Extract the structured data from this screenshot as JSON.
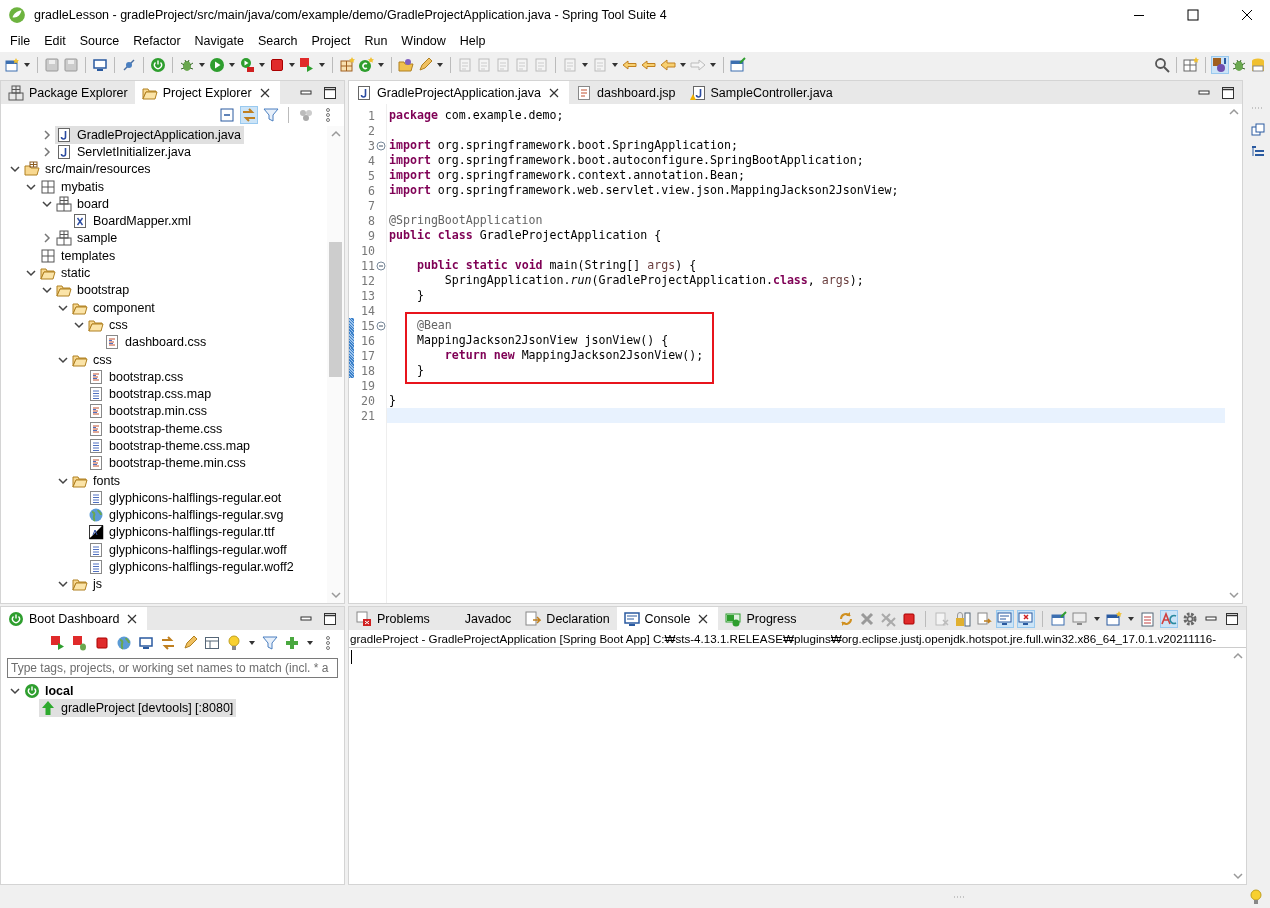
{
  "window": {
    "title": "gradleLesson - gradleProject/src/main/java/com/example/demo/GradleProjectApplication.java - Spring Tool Suite 4"
  },
  "menu": [
    "File",
    "Edit",
    "Source",
    "Refactor",
    "Navigate",
    "Search",
    "Project",
    "Run",
    "Window",
    "Help"
  ],
  "explorer": {
    "tabs": [
      {
        "label": "Package Explorer",
        "selected": false
      },
      {
        "label": "Project Explorer",
        "selected": true
      }
    ],
    "link_with_editor": true,
    "scrolled_items": [
      {
        "label": "GradleProjectApplication.java",
        "kind": "java",
        "expanded": false,
        "selected": true
      },
      {
        "label": "ServletInitializer.java",
        "kind": "java",
        "expanded": false,
        "selected": false
      }
    ],
    "tree": [
      {
        "label": "src/main/resources",
        "kind": "source-folder",
        "expanded": true,
        "selected": false,
        "children": [
          {
            "label": "mybatis",
            "kind": "package",
            "expanded": true,
            "selected": false,
            "children": [
              {
                "label": "board",
                "kind": "package-tree",
                "expanded": true,
                "selected": false,
                "children": [
                  {
                    "label": "BoardMapper.xml",
                    "kind": "xml",
                    "selected": false
                  }
                ]
              },
              {
                "label": "sample",
                "kind": "package-tree",
                "expanded": false,
                "selected": false
              }
            ]
          },
          {
            "label": "templates",
            "kind": "package",
            "selected": false
          },
          {
            "label": "static",
            "kind": "folder",
            "expanded": true,
            "selected": false,
            "children": [
              {
                "label": "bootstrap",
                "kind": "folder",
                "expanded": true,
                "selected": false,
                "children": [
                  {
                    "label": "component",
                    "kind": "folder",
                    "expanded": true,
                    "selected": false,
                    "children": [
                      {
                        "label": "css",
                        "kind": "folder",
                        "expanded": true,
                        "selected": false,
                        "children": [
                          {
                            "label": "dashboard.css",
                            "kind": "css",
                            "selected": false
                          }
                        ]
                      }
                    ]
                  },
                  {
                    "label": "css",
                    "kind": "folder",
                    "expanded": true,
                    "selected": false,
                    "children": [
                      {
                        "label": "bootstrap.css",
                        "kind": "css",
                        "selected": false
                      },
                      {
                        "label": "bootstrap.css.map",
                        "kind": "text",
                        "selected": false
                      },
                      {
                        "label": "bootstrap.min.css",
                        "kind": "css",
                        "selected": false
                      },
                      {
                        "label": "bootstrap-theme.css",
                        "kind": "css",
                        "selected": false
                      },
                      {
                        "label": "bootstrap-theme.css.map",
                        "kind": "text",
                        "selected": false
                      },
                      {
                        "label": "bootstrap-theme.min.css",
                        "kind": "css",
                        "selected": false
                      }
                    ]
                  },
                  {
                    "label": "fonts",
                    "kind": "folder",
                    "expanded": true,
                    "selected": false,
                    "children": [
                      {
                        "label": "glyphicons-halflings-regular.eot",
                        "kind": "text",
                        "selected": false
                      },
                      {
                        "label": "glyphicons-halflings-regular.svg",
                        "kind": "globe",
                        "selected": false
                      },
                      {
                        "label": "glyphicons-halflings-regular.ttf",
                        "kind": "font",
                        "selected": false
                      },
                      {
                        "label": "glyphicons-halflings-regular.woff",
                        "kind": "text",
                        "selected": false
                      },
                      {
                        "label": "glyphicons-halflings-regular.woff2",
                        "kind": "text",
                        "selected": false
                      }
                    ]
                  },
                  {
                    "label": "js",
                    "kind": "folder",
                    "expanded": true,
                    "selected": false
                  }
                ]
              }
            ]
          }
        ]
      }
    ]
  },
  "editor": {
    "tabs": [
      {
        "label": "GradleProjectApplication.java",
        "kind": "java",
        "selected": true
      },
      {
        "label": "dashboard.jsp",
        "kind": "jsp",
        "selected": false
      },
      {
        "label": "SampleController.java",
        "kind": "java-warning",
        "selected": false
      }
    ],
    "lines": [
      {
        "number": "1",
        "segments": [
          {
            "kind": "kw",
            "text": "package"
          },
          {
            "kind": "plain",
            "text": " com.example.demo;"
          }
        ]
      },
      {
        "number": "2"
      },
      {
        "number": "3",
        "foldable": true,
        "segments": [
          {
            "kind": "kw",
            "text": "import"
          },
          {
            "kind": "plain",
            "text": " org.springframework.boot.SpringApplication;"
          }
        ]
      },
      {
        "number": "4",
        "segments": [
          {
            "kind": "kw",
            "text": "import"
          },
          {
            "kind": "plain",
            "text": " org.springframework.boot.autoconfigure.SpringBootApplication;"
          }
        ]
      },
      {
        "number": "5",
        "segments": [
          {
            "kind": "kw",
            "text": "import"
          },
          {
            "kind": "plain",
            "text": " org.springframework.context.annotation.Bean;"
          }
        ]
      },
      {
        "number": "6",
        "segments": [
          {
            "kind": "kw",
            "text": "import"
          },
          {
            "kind": "plain",
            "text": " org.springframework.web.servlet.view.json.MappingJackson2JsonView;"
          }
        ]
      },
      {
        "number": "7"
      },
      {
        "number": "8",
        "segments": [
          {
            "kind": "annotation",
            "text": "@SpringBootApplication"
          }
        ]
      },
      {
        "number": "9",
        "segments": [
          {
            "kind": "kw",
            "text": "public"
          },
          {
            "kind": "kw",
            "text": " class"
          },
          {
            "kind": "plain",
            "text": " GradleProjectApplication {"
          }
        ]
      },
      {
        "number": "10"
      },
      {
        "number": "11",
        "foldable": true,
        "segments": [
          {
            "kind": "kw",
            "text": "    public"
          },
          {
            "kind": "kw",
            "text": " static"
          },
          {
            "kind": "kw",
            "text": " void"
          },
          {
            "kind": "plain",
            "text": " main(String[] "
          },
          {
            "kind": "var",
            "text": "args"
          },
          {
            "kind": "plain",
            "text": ") {"
          }
        ]
      },
      {
        "number": "12",
        "segments": [
          {
            "kind": "plain",
            "text": "        SpringApplication."
          },
          {
            "kind": "static",
            "text": "run"
          },
          {
            "kind": "plain",
            "text": "(GradleProjectApplication."
          },
          {
            "kind": "kw",
            "text": "class"
          },
          {
            "kind": "plain",
            "text": ", "
          },
          {
            "kind": "var",
            "text": "args"
          },
          {
            "kind": "plain",
            "text": ");"
          }
        ]
      },
      {
        "number": "13",
        "segments": [
          {
            "kind": "plain",
            "text": "    }"
          }
        ]
      },
      {
        "number": "14"
      },
      {
        "number": "15",
        "foldable": true,
        "changed": true,
        "boxed": true,
        "segments": [
          {
            "kind": "annotation",
            "text": "    @Bean"
          }
        ]
      },
      {
        "number": "16",
        "changed": true,
        "boxed": true,
        "segments": [
          {
            "kind": "plain",
            "text": "    MappingJackson2JsonView jsonView() {"
          }
        ]
      },
      {
        "number": "17",
        "changed": true,
        "boxed": true,
        "segments": [
          {
            "kind": "kw",
            "text": "        return"
          },
          {
            "kind": "kw",
            "text": " new"
          },
          {
            "kind": "plain",
            "text": " MappingJackson2JsonView();"
          }
        ]
      },
      {
        "number": "18",
        "changed": true,
        "boxed": true,
        "segments": [
          {
            "kind": "plain",
            "text": "    }"
          }
        ]
      },
      {
        "number": "19"
      },
      {
        "number": "20",
        "segments": [
          {
            "kind": "plain",
            "text": "}"
          }
        ]
      },
      {
        "number": "21",
        "current": true
      }
    ]
  },
  "boot_dashboard": {
    "tabs": [
      {
        "label": "Boot Dashboard",
        "selected": true
      }
    ],
    "filter": {
      "placeholder": "Type tags, projects, or working set names to match (incl. * a"
    },
    "tree": [
      {
        "label": "local",
        "expanded": true,
        "selected": false,
        "children": [
          {
            "label": "gradleProject [devtools] [:8080]",
            "running": true,
            "selected": true
          }
        ]
      }
    ]
  },
  "console": {
    "tabs": [
      {
        "label": "Problems",
        "kind": "problems",
        "selected": false
      },
      {
        "label": "Javadoc",
        "kind": "javadoc",
        "selected": false
      },
      {
        "label": "Declaration",
        "kind": "declaration",
        "selected": false
      },
      {
        "label": "Console",
        "kind": "console",
        "selected": true
      },
      {
        "label": "Progress",
        "kind": "progress",
        "selected": false
      }
    ],
    "pin": true,
    "show_on_output": true,
    "word_wrap": true,
    "header": "gradleProject - GradleProjectApplication [Spring Boot App] C:₩sts-4.13.1.RELEASE₩plugins₩org.eclipse.justj.openjdk.hotspot.jre.full.win32.x86_64_17.0.1.v20211116-"
  }
}
